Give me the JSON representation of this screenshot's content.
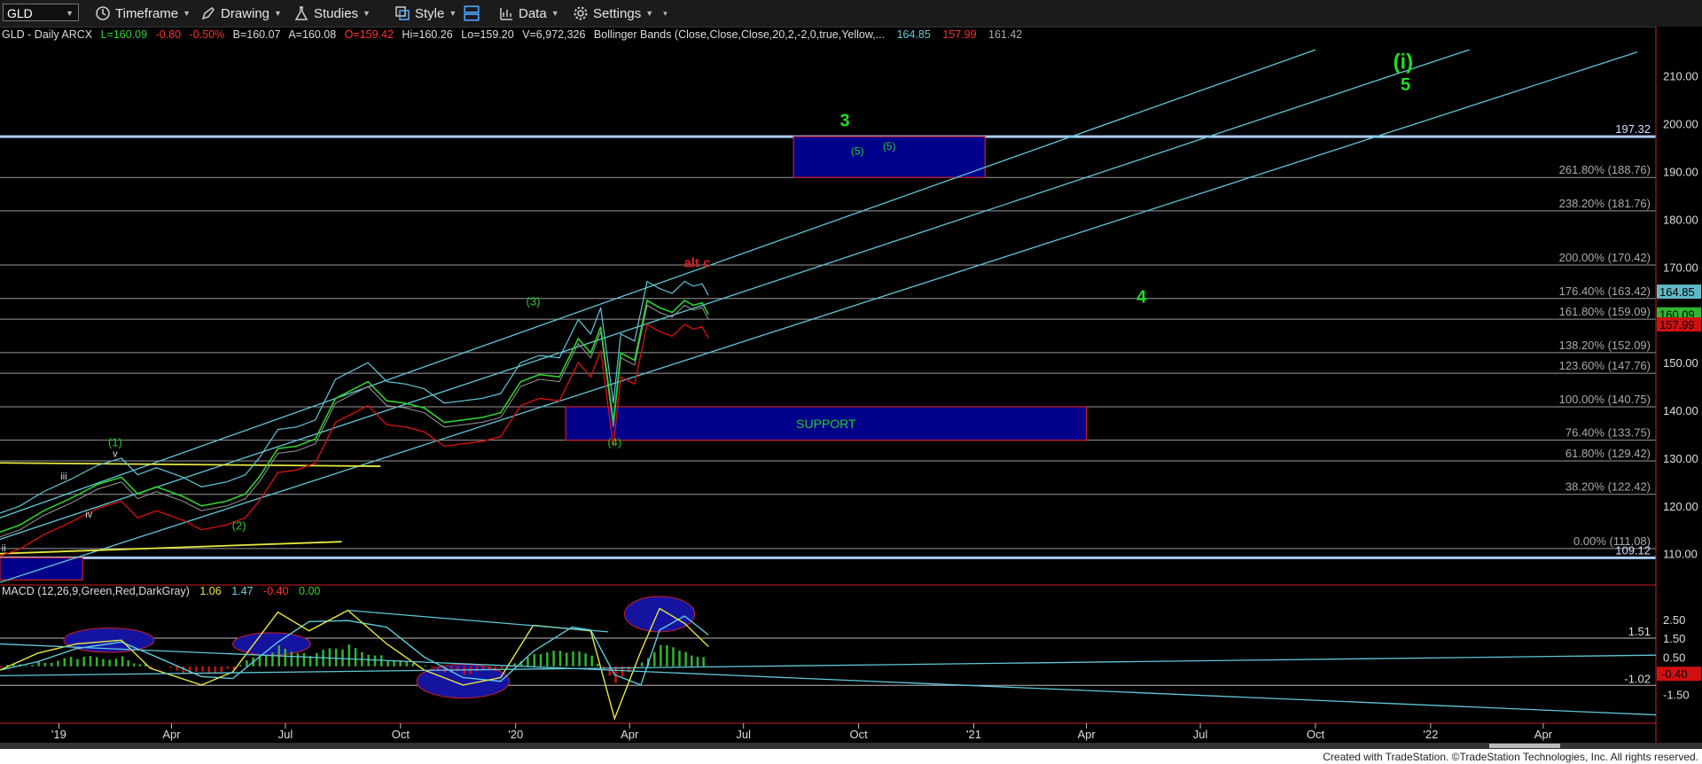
{
  "toolbar": {
    "symbol": "GLD",
    "timeframe_label": "Timeframe",
    "drawing_label": "Drawing",
    "studies_label": "Studies",
    "style_label": "Style",
    "data_label": "Data",
    "settings_label": "Settings"
  },
  "price_header": {
    "symbol_line": "GLD - Daily  ARCX",
    "last": "L=160.09",
    "change": "-0.80",
    "pct": "-0.50%",
    "bid": "B=160.07",
    "ask": "A=160.08",
    "open": "O=159.42",
    "high": "Hi=160.26",
    "low": "Lo=159.20",
    "volume": "V=6,972,326",
    "bb_label": "Bollinger Bands (Close,Close,Close,20,2,-2,0,true,Yellow,...",
    "bb_upper": "164.85",
    "bb_lower": "157.99",
    "bb_mid": "161.42"
  },
  "macd_header": {
    "label": "MACD (12,26,9,Green,Red,DarkGray)",
    "v1": "1.06",
    "v2": "1.47",
    "v3": "-0.40",
    "v4": "0.00"
  },
  "footer": {
    "text": "Created with TradeStation. ©TradeStation Technologies, Inc. All rights reserved."
  },
  "chart_data": {
    "type": "line",
    "title": "GLD - Daily",
    "price_axis": {
      "ylim": [
        104,
        217
      ],
      "ticks": [
        110,
        120,
        130,
        140,
        150,
        160,
        170,
        180,
        190,
        200,
        210
      ]
    },
    "time_axis": {
      "labels": [
        "'19",
        "Apr",
        "Jul",
        "Oct",
        "'20",
        "Apr",
        "Jul",
        "Oct",
        "'21",
        "Apr",
        "Jul",
        "Oct",
        "'22",
        "Apr"
      ],
      "range": [
        "2018-11-15",
        "2022-06-30"
      ]
    },
    "fib_levels": [
      {
        "label": "261.80% (188.76)",
        "value": 188.76
      },
      {
        "label": "238.20% (181.76)",
        "value": 181.76
      },
      {
        "label": "200.00% (170.42)",
        "value": 170.42
      },
      {
        "label": "176.40% (163.42)",
        "value": 163.42
      },
      {
        "label": "161.80% (159.09)",
        "value": 159.09
      },
      {
        "label": "138.20% (152.09)",
        "value": 152.09
      },
      {
        "label": "123.60% (147.76)",
        "value": 147.76
      },
      {
        "label": "100.00% (140.75)",
        "value": 140.75
      },
      {
        "label": "76.40% (133.75)",
        "value": 133.75
      },
      {
        "label": "61.80% (129.42)",
        "value": 129.42
      },
      {
        "label": "38.20% (122.42)",
        "value": 122.42
      },
      {
        "label": "0.00% (111.08)",
        "value": 111.08
      }
    ],
    "horizontal_lines": [
      {
        "label": "197.32",
        "value": 197.32,
        "color": "#aaccff"
      },
      {
        "label": "109.12",
        "value": 109.12,
        "color": "#aaccff"
      }
    ],
    "price_badges": [
      {
        "label": "164.85",
        "value": 164.85,
        "color": "#5fb8c8"
      },
      {
        "label": "160.09",
        "value": 160.09,
        "color": "#2fb52f"
      },
      {
        "label": "157.99",
        "value": 157.99,
        "color": "#d01010"
      }
    ],
    "boxes": [
      {
        "label": "(5)",
        "x0": "2020-08-10",
        "x1": "2021-01-10",
        "y0": 188.76,
        "y1": 197.32
      },
      {
        "label": "SUPPORT",
        "x0": "2020-02-10",
        "x1": "2021-04-01",
        "y0": 133.75,
        "y1": 140.75
      },
      {
        "label": "",
        "x0": "2018-11-15",
        "x1": "2019-01-20",
        "y0": 104.5,
        "y1": 109.12
      }
    ],
    "wave_labels": [
      {
        "text": "3",
        "x": "2020-09-20",
        "y": 199.5,
        "color": "#22dd22",
        "size": 20
      },
      {
        "text": "(5)",
        "x": "2020-09-30",
        "y": 193.5,
        "color": "#22cc22",
        "size": 12
      },
      {
        "text": "(i)",
        "x": "2021-12-10",
        "y": 211.5,
        "color": "#22dd22",
        "size": 24
      },
      {
        "text": "5",
        "x": "2021-12-12",
        "y": 207.0,
        "color": "#22dd22",
        "size": 20
      },
      {
        "text": "alt c",
        "x": "2020-05-25",
        "y": 170.0,
        "color": "#dd2020",
        "size": 15
      },
      {
        "text": "4",
        "x": "2021-05-15",
        "y": 162.5,
        "color": "#22dd22",
        "size": 20
      },
      {
        "text": "(3)",
        "x": "2020-01-15",
        "y": 162.0,
        "color": "#22cc22",
        "size": 13
      },
      {
        "text": "(4)",
        "x": "2020-03-20",
        "y": 132.5,
        "color": "#22cc22",
        "size": 13
      },
      {
        "text": "(1)",
        "x": "2019-02-15",
        "y": 132.5,
        "color": "#22cc22",
        "size": 13
      },
      {
        "text": "v",
        "x": "2019-02-15",
        "y": 130.3,
        "color": "#dddddd",
        "size": 11
      },
      {
        "text": "iii",
        "x": "2019-01-05",
        "y": 125.5,
        "color": "#dddddd",
        "size": 11
      },
      {
        "text": "iv",
        "x": "2019-01-25",
        "y": 117.5,
        "color": "#dddddd",
        "size": 11
      },
      {
        "text": "(2)",
        "x": "2019-05-25",
        "y": 115.0,
        "color": "#22cc22",
        "size": 13
      },
      {
        "text": "ii",
        "x": "2018-11-18",
        "y": 110.5,
        "color": "#dddddd",
        "size": 11
      }
    ],
    "channel_lines": [
      {
        "x0": "2018-11-15",
        "y0": 117.5,
        "x1": "2021-10-01",
        "y1": 215.5
      },
      {
        "x0": "2018-11-15",
        "y0": 113.0,
        "x1": "2022-02-01",
        "y1": 215.5
      },
      {
        "x0": "2018-11-15",
        "y0": 104.0,
        "x1": "2022-06-15",
        "y1": 215.0
      }
    ],
    "trend_lines": [
      {
        "x0": "2018-11-15",
        "y0": 129.0,
        "x1": "2019-09-15",
        "y1": 128.3,
        "color": "#e8e840"
      },
      {
        "x0": "2018-11-15",
        "y0": 110.0,
        "x1": "2019-08-15",
        "y1": 112.5,
        "color": "#e8e840"
      }
    ],
    "price_series": [
      [
        "2018-11-15",
        114.5
      ],
      [
        "2018-12-01",
        116.0
      ],
      [
        "2018-12-20",
        119.0
      ],
      [
        "2019-01-10",
        121.5
      ],
      [
        "2019-02-01",
        124.5
      ],
      [
        "2019-02-20",
        126.0
      ],
      [
        "2019-03-05",
        122.5
      ],
      [
        "2019-03-20",
        124.0
      ],
      [
        "2019-04-10",
        122.0
      ],
      [
        "2019-04-25",
        120.0
      ],
      [
        "2019-05-15",
        121.0
      ],
      [
        "2019-05-30",
        122.5
      ],
      [
        "2019-06-10",
        126.0
      ],
      [
        "2019-06-25",
        132.0
      ],
      [
        "2019-07-10",
        132.5
      ],
      [
        "2019-07-25",
        134.0
      ],
      [
        "2019-08-10",
        142.5
      ],
      [
        "2019-08-25",
        144.5
      ],
      [
        "2019-09-05",
        146.0
      ],
      [
        "2019-09-20",
        142.0
      ],
      [
        "2019-10-05",
        141.5
      ],
      [
        "2019-10-20",
        140.5
      ],
      [
        "2019-11-05",
        137.5
      ],
      [
        "2019-11-20",
        138.0
      ],
      [
        "2019-12-05",
        138.5
      ],
      [
        "2019-12-20",
        139.5
      ],
      [
        "2020-01-05",
        146.0
      ],
      [
        "2020-01-20",
        147.5
      ],
      [
        "2020-02-05",
        147.0
      ],
      [
        "2020-02-20",
        155.0
      ],
      [
        "2020-03-01",
        152.0
      ],
      [
        "2020-03-09",
        157.5
      ],
      [
        "2020-03-19",
        137.5
      ],
      [
        "2020-03-25",
        152.0
      ],
      [
        "2020-04-05",
        150.5
      ],
      [
        "2020-04-15",
        163.0
      ],
      [
        "2020-04-25",
        161.5
      ],
      [
        "2020-05-05",
        160.5
      ],
      [
        "2020-05-15",
        163.0
      ],
      [
        "2020-05-22",
        162.0
      ],
      [
        "2020-05-29",
        162.5
      ],
      [
        "2020-06-03",
        160.09
      ]
    ],
    "macd_axis": {
      "ylim": [
        -3.0,
        3.6
      ],
      "ticks": [
        "2.50",
        "1.50",
        "0.50",
        "-0.40",
        "-1.50"
      ]
    },
    "macd_levels": [
      {
        "label": "1.51",
        "value": 1.51
      },
      {
        "label": "-1.02",
        "value": -1.02
      }
    ],
    "macd_series": [
      [
        "2018-11-15",
        -0.2
      ],
      [
        "2018-12-15",
        0.7
      ],
      [
        "2019-01-15",
        1.2
      ],
      [
        "2019-02-20",
        1.4
      ],
      [
        "2019-03-15",
        -0.1
      ],
      [
        "2019-04-25",
        -1.0
      ],
      [
        "2019-05-20",
        -0.3
      ],
      [
        "2019-06-25",
        2.9
      ],
      [
        "2019-07-20",
        1.9
      ],
      [
        "2019-08-20",
        3.0
      ],
      [
        "2019-09-20",
        1.2
      ],
      [
        "2019-10-20",
        -0.2
      ],
      [
        "2019-11-20",
        -1.0
      ],
      [
        "2019-12-20",
        -0.6
      ],
      [
        "2020-01-15",
        2.2
      ],
      [
        "2020-02-15",
        2.0
      ],
      [
        "2020-03-01",
        1.9
      ],
      [
        "2020-03-20",
        -2.8
      ],
      [
        "2020-04-10",
        0.8
      ],
      [
        "2020-04-25",
        3.1
      ],
      [
        "2020-05-15",
        2.3
      ],
      [
        "2020-06-03",
        1.06
      ]
    ],
    "macd_lines": [
      {
        "x0": "2019-08-20",
        "y0": 3.0,
        "x1": "2020-03-15",
        "y1": 1.85
      },
      {
        "x0": "2018-11-15",
        "y0": -0.5,
        "x1": "2022-06-30",
        "y1": 0.6
      },
      {
        "x0": "2018-11-15",
        "y0": 1.2,
        "x1": "2022-06-30",
        "y1": -2.6
      }
    ],
    "macd_ellipses": [
      {
        "x": "2019-02-10",
        "y": 1.4,
        "rx_days": 36,
        "ry": 0.65
      },
      {
        "x": "2019-06-20",
        "y": 1.2,
        "rx_days": 31,
        "ry": 0.6
      },
      {
        "x": "2019-11-20",
        "y": -0.8,
        "rx_days": 37,
        "ry": 0.9
      },
      {
        "x": "2020-04-25",
        "y": 2.8,
        "rx_days": 28,
        "ry": 0.95
      }
    ]
  }
}
